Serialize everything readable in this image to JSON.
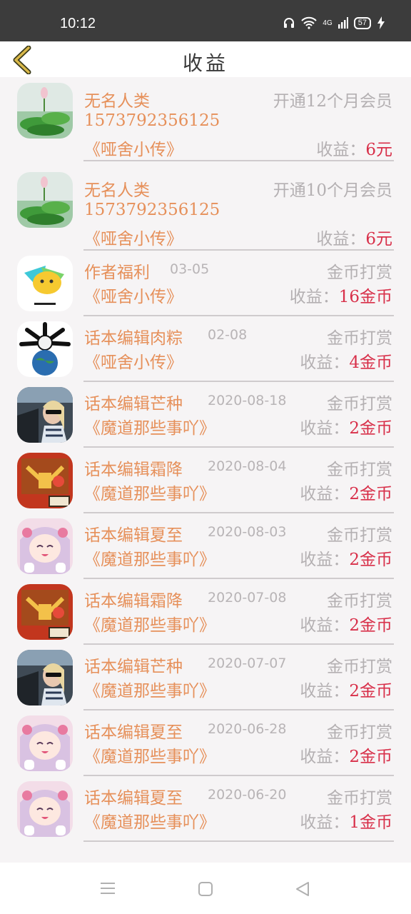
{
  "status": {
    "time": "10:12",
    "network": "4G",
    "battery": "57"
  },
  "header": {
    "title": "收益"
  },
  "income_label": "收益：",
  "vip_items": [
    {
      "name": "无名人类",
      "type": "开通12个月会员",
      "phone": "1573792356125",
      "book": "《哑舍小传》",
      "value": "6元"
    },
    {
      "name": "无名人类",
      "type": "开通10个月会员",
      "phone": "1573792356125",
      "book": "《哑舍小传》",
      "value": "6元"
    }
  ],
  "coin_items": [
    {
      "name": "作者福利",
      "date": "03-05",
      "type": "金币打赏",
      "book": "《哑舍小传》",
      "value": "16金币",
      "avatar": "yellow"
    },
    {
      "name": "话本编辑肉粽",
      "date": "02-08",
      "type": "金币打赏",
      "book": "《哑舍小传》",
      "value": "4金币",
      "avatar": "earth"
    },
    {
      "name": "话本编辑芒种",
      "date": "2020-08-18",
      "type": "金币打赏",
      "book": "《魔道那些事吖》",
      "value": "2金币",
      "avatar": "car"
    },
    {
      "name": "话本编辑霜降",
      "date": "2020-08-04",
      "type": "金币打赏",
      "book": "《魔道那些事吖》",
      "value": "2金币",
      "avatar": "red"
    },
    {
      "name": "话本编辑夏至",
      "date": "2020-08-03",
      "type": "金币打赏",
      "book": "《魔道那些事吖》",
      "value": "2金币",
      "avatar": "anime"
    },
    {
      "name": "话本编辑霜降",
      "date": "2020-07-08",
      "type": "金币打赏",
      "book": "《魔道那些事吖》",
      "value": "2金币",
      "avatar": "red"
    },
    {
      "name": "话本编辑芒种",
      "date": "2020-07-07",
      "type": "金币打赏",
      "book": "《魔道那些事吖》",
      "value": "2金币",
      "avatar": "car"
    },
    {
      "name": "话本编辑夏至",
      "date": "2020-06-28",
      "type": "金币打赏",
      "book": "《魔道那些事吖》",
      "value": "2金币",
      "avatar": "anime"
    },
    {
      "name": "话本编辑夏至",
      "date": "2020-06-20",
      "type": "金币打赏",
      "book": "《魔道那些事吖》",
      "value": "1金币",
      "avatar": "anime"
    }
  ]
}
